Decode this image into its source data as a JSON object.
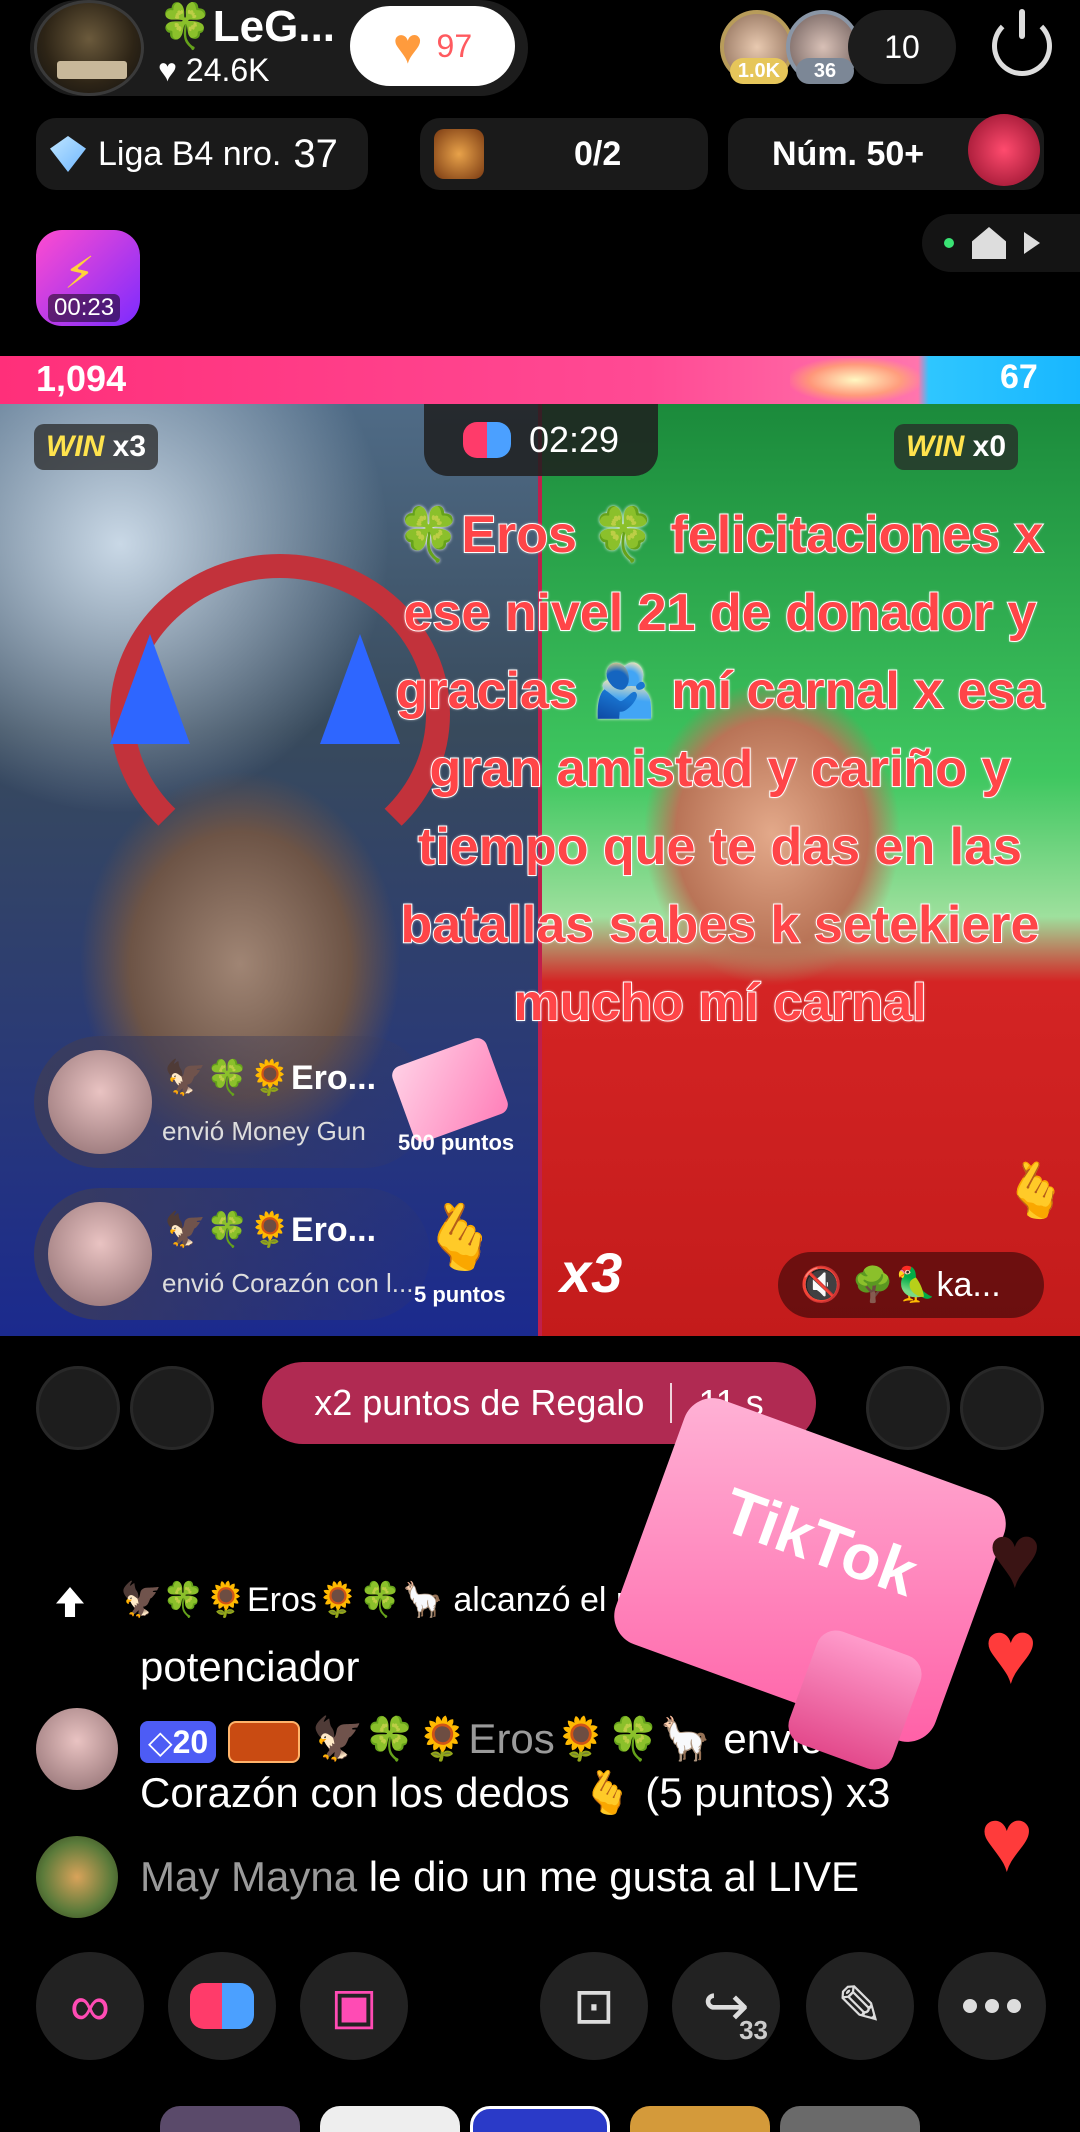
{
  "host": {
    "name": "🍀LeG...",
    "likes": "♥ 24.6K",
    "follow_count": "97"
  },
  "viewers": [
    {
      "badge": "1.0K",
      "color": "#e6c65a"
    },
    {
      "badge": "36",
      "color": "#7c8796"
    }
  ],
  "viewer_count": "10",
  "info": {
    "league_text": "Liga B4 nro.",
    "league_number": "37",
    "battle_progress": "0/2",
    "rank": "Núm. 50+"
  },
  "reward_timer": "00:23",
  "battle": {
    "score_left": "1,094",
    "score_right": "67",
    "timer": "02:29",
    "win_left_label": "WIN",
    "win_left_count": "x3",
    "win_right_label": "WIN",
    "win_right_count": "x0",
    "overlay_message": "🍀Eros 🍀 felicitaciones x ese nivel 21 de donador y gracias 🫂 mí carnal x esa gran amistad y cariño y tiempo que te das en las batallas sabes k setekiere mucho mí carnal",
    "gifts": [
      {
        "name": "🦅🍀🌻Ero...",
        "message": "envió Money Gun",
        "points": "500 puntos"
      },
      {
        "name": "🦅🍀🌻Ero...",
        "message": "envió Corazón con l...",
        "points": "5 puntos"
      }
    ],
    "combo": "x3",
    "muted_user": "🔇 🌳🦜ka..."
  },
  "boost": {
    "label": "x2 puntos de Regalo",
    "time": "11 s"
  },
  "chat": {
    "level_event": "🦅🍀🌻Eros🌻🍀🦙 alcanzó el nivel",
    "boost_line": "potenciador",
    "gift_message": {
      "level": "20",
      "user": "🦅🍀🌻Eros🌻🍀🦙",
      "verb": "envió",
      "text": "Corazón con los dedos 🫰 (5 puntos) x3"
    },
    "like_message": {
      "user": "May Mayna",
      "text": "le dio un me gusta al LIVE"
    }
  },
  "gift_overlay_label": "TikTok",
  "toolbar": {
    "share_count": "33"
  },
  "colors": {
    "accent_pink": "#ff2f7a",
    "accent_blue": "#18b7ff",
    "boost_pill": "#b02a52"
  }
}
